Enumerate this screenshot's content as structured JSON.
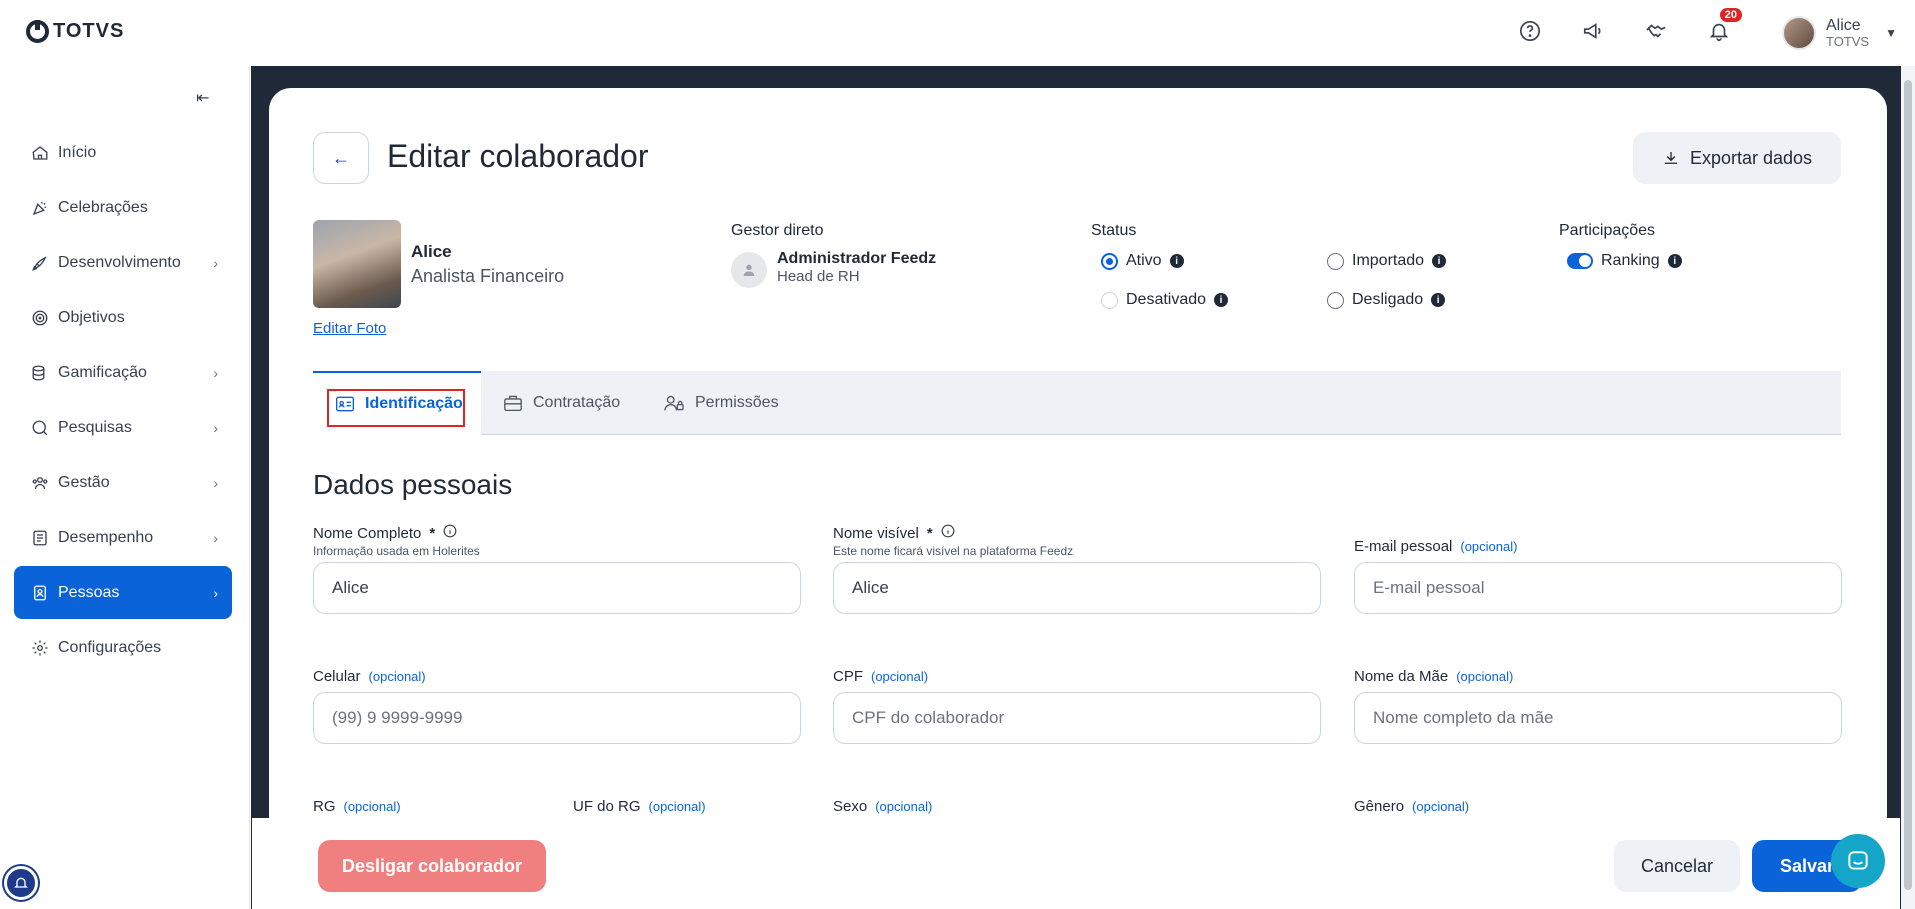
{
  "brand": {
    "logo_text": "TOTVS"
  },
  "header": {
    "notification_count": "20",
    "user_name": "Alice",
    "user_org": "TOTVS"
  },
  "sidebar": {
    "items": [
      {
        "label": "Início",
        "icon": "home-icon"
      },
      {
        "label": "Celebrações",
        "icon": "party-icon"
      },
      {
        "label": "Desenvolvimento",
        "icon": "rocket-icon"
      },
      {
        "label": "Objetivos",
        "icon": "target-icon"
      },
      {
        "label": "Gamificação",
        "icon": "coins-icon"
      },
      {
        "label": "Pesquisas",
        "icon": "search-icon"
      },
      {
        "label": "Gestão",
        "icon": "users-icon"
      },
      {
        "label": "Desempenho",
        "icon": "checklist-icon"
      },
      {
        "label": "Pessoas",
        "icon": "badge-icon"
      },
      {
        "label": "Configurações",
        "icon": "gear-icon"
      }
    ]
  },
  "page": {
    "title": "Editar colaborador",
    "export_label": "Exportar dados"
  },
  "profile": {
    "name": "Alice",
    "role": "Analista Financeiro",
    "edit_photo": "Editar Foto"
  },
  "manager": {
    "label": "Gestor direto",
    "name": "Administrador Feedz",
    "role": "Head de RH"
  },
  "status": {
    "label": "Status",
    "options": [
      "Ativo",
      "Importado",
      "Desativado",
      "Desligado"
    ],
    "selected": "Ativo"
  },
  "participation": {
    "label": "Participações",
    "ranking_label": "Ranking",
    "ranking_on": true
  },
  "tabs": [
    {
      "label": "Identificação"
    },
    {
      "label": "Contratação"
    },
    {
      "label": "Permissões"
    }
  ],
  "form": {
    "section_title": "Dados pessoais",
    "optional": "(opcional)",
    "full_name": {
      "label": "Nome Completo",
      "hint": "Informação usada em Holerites",
      "value": "Alice"
    },
    "visible_name": {
      "label": "Nome visível",
      "hint": "Este nome ficará visível na plataforma Feedz",
      "value": "Alice"
    },
    "personal_email": {
      "label": "E-mail pessoal",
      "placeholder": "E-mail pessoal"
    },
    "phone": {
      "label": "Celular",
      "placeholder": "(99) 9 9999-9999"
    },
    "cpf": {
      "label": "CPF",
      "placeholder": "CPF do colaborador"
    },
    "mother_name": {
      "label": "Nome da Mãe",
      "placeholder": "Nome completo da mãe"
    },
    "rg": {
      "label": "RG"
    },
    "rg_uf": {
      "label": "UF do RG"
    },
    "sex": {
      "label": "Sexo"
    },
    "gender": {
      "label": "Gênero"
    }
  },
  "footer": {
    "desligar": "Desligar colaborador",
    "cancel": "Cancelar",
    "save": "Salvar"
  }
}
